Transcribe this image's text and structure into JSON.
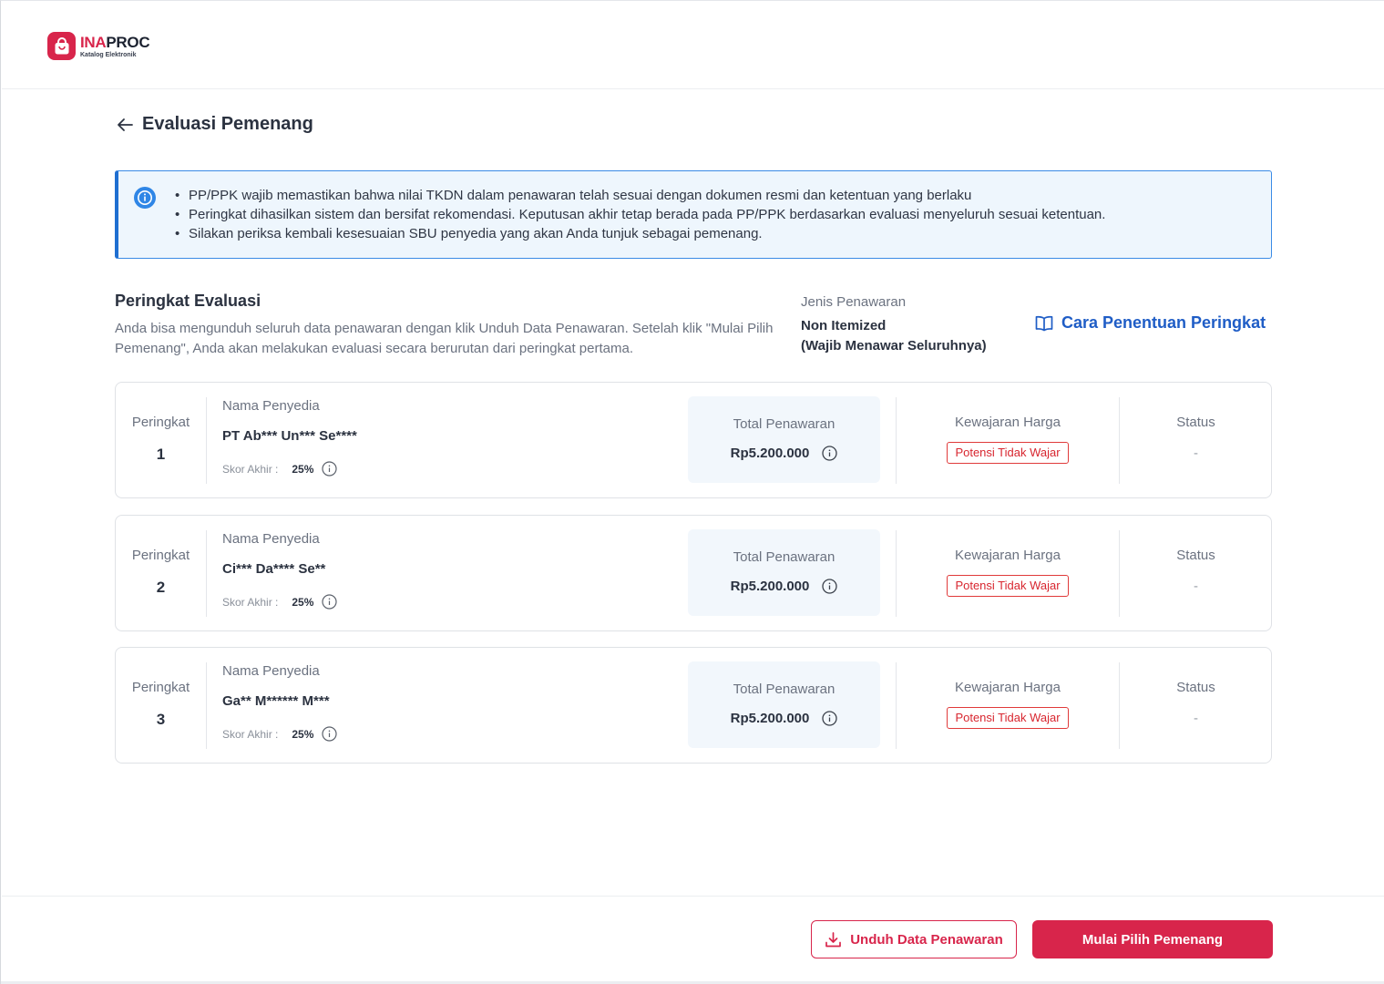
{
  "brand": {
    "name_part1": "INA",
    "name_part2": "PROC",
    "subtitle": "Katalog Elektronik",
    "color": "#d8254b"
  },
  "page": {
    "title": "Evaluasi Pemenang",
    "back_icon": "arrow-left-icon"
  },
  "info": {
    "icon": "info-icon",
    "items": [
      "PP/PPK wajib memastikan bahwa nilai TKDN dalam penawaran telah sesuai dengan dokumen resmi dan ketentuan yang berlaku",
      "Peringkat dihasilkan sistem dan bersifat rekomendasi. Keputusan akhir tetap berada pada PP/PPK berdasarkan evaluasi menyeluruh sesuai ketentuan.",
      "Silakan periksa kembali kesesuaian SBU penyedia yang akan Anda tunjuk sebagai pemenang."
    ]
  },
  "evaluation": {
    "title": "Peringkat Evaluasi",
    "description": "Anda bisa mengunduh seluruh data penawaran dengan klik Unduh Data Penawaran. Setelah klik \"Mulai Pilih Pemenang\", Anda akan melakukan evaluasi secara berurutan dari peringkat pertama.",
    "jenis_label": "Jenis Penawaran",
    "jenis_value_line1": "Non Itemized",
    "jenis_value_line2": "(Wajib Menawar Seluruhnya)",
    "cara_link": "Cara Penentuan Peringkat"
  },
  "ranks": [
    {
      "rank_label": "Peringkat",
      "rank": "1",
      "vendor_label": "Nama Penyedia",
      "vendor_name": "PT Ab*** Un*** Se****",
      "score_label": "Skor Akhir :",
      "score": "25%",
      "total_label": "Total Penawaran",
      "total": "Rp5.200.000",
      "kewajaran_label": "Kewajaran Harga",
      "kewajaran": "Potensi Tidak Wajar",
      "status_label": "Status",
      "status": "-"
    },
    {
      "rank_label": "Peringkat",
      "rank": "2",
      "vendor_label": "Nama Penyedia",
      "vendor_name": "Ci*** Da**** Se**",
      "score_label": "Skor Akhir :",
      "score": "25%",
      "total_label": "Total Penawaran",
      "total": "Rp5.200.000",
      "kewajaran_label": "Kewajaran Harga",
      "kewajaran": "Potensi Tidak Wajar",
      "status_label": "Status",
      "status": "-"
    },
    {
      "rank_label": "Peringkat",
      "rank": "3",
      "vendor_label": "Nama Penyedia",
      "vendor_name": "Ga** M****** M***",
      "score_label": "Skor Akhir :",
      "score": "25%",
      "total_label": "Total Penawaran",
      "total": "Rp5.200.000",
      "kewajaran_label": "Kewajaran Harga",
      "kewajaran": "Potensi Tidak Wajar",
      "status_label": "Status",
      "status": "-"
    }
  ],
  "footer": {
    "download_label": "Unduh Data Penawaran",
    "download_icon": "download-icon",
    "start_label": "Mulai Pilih Pemenang"
  }
}
